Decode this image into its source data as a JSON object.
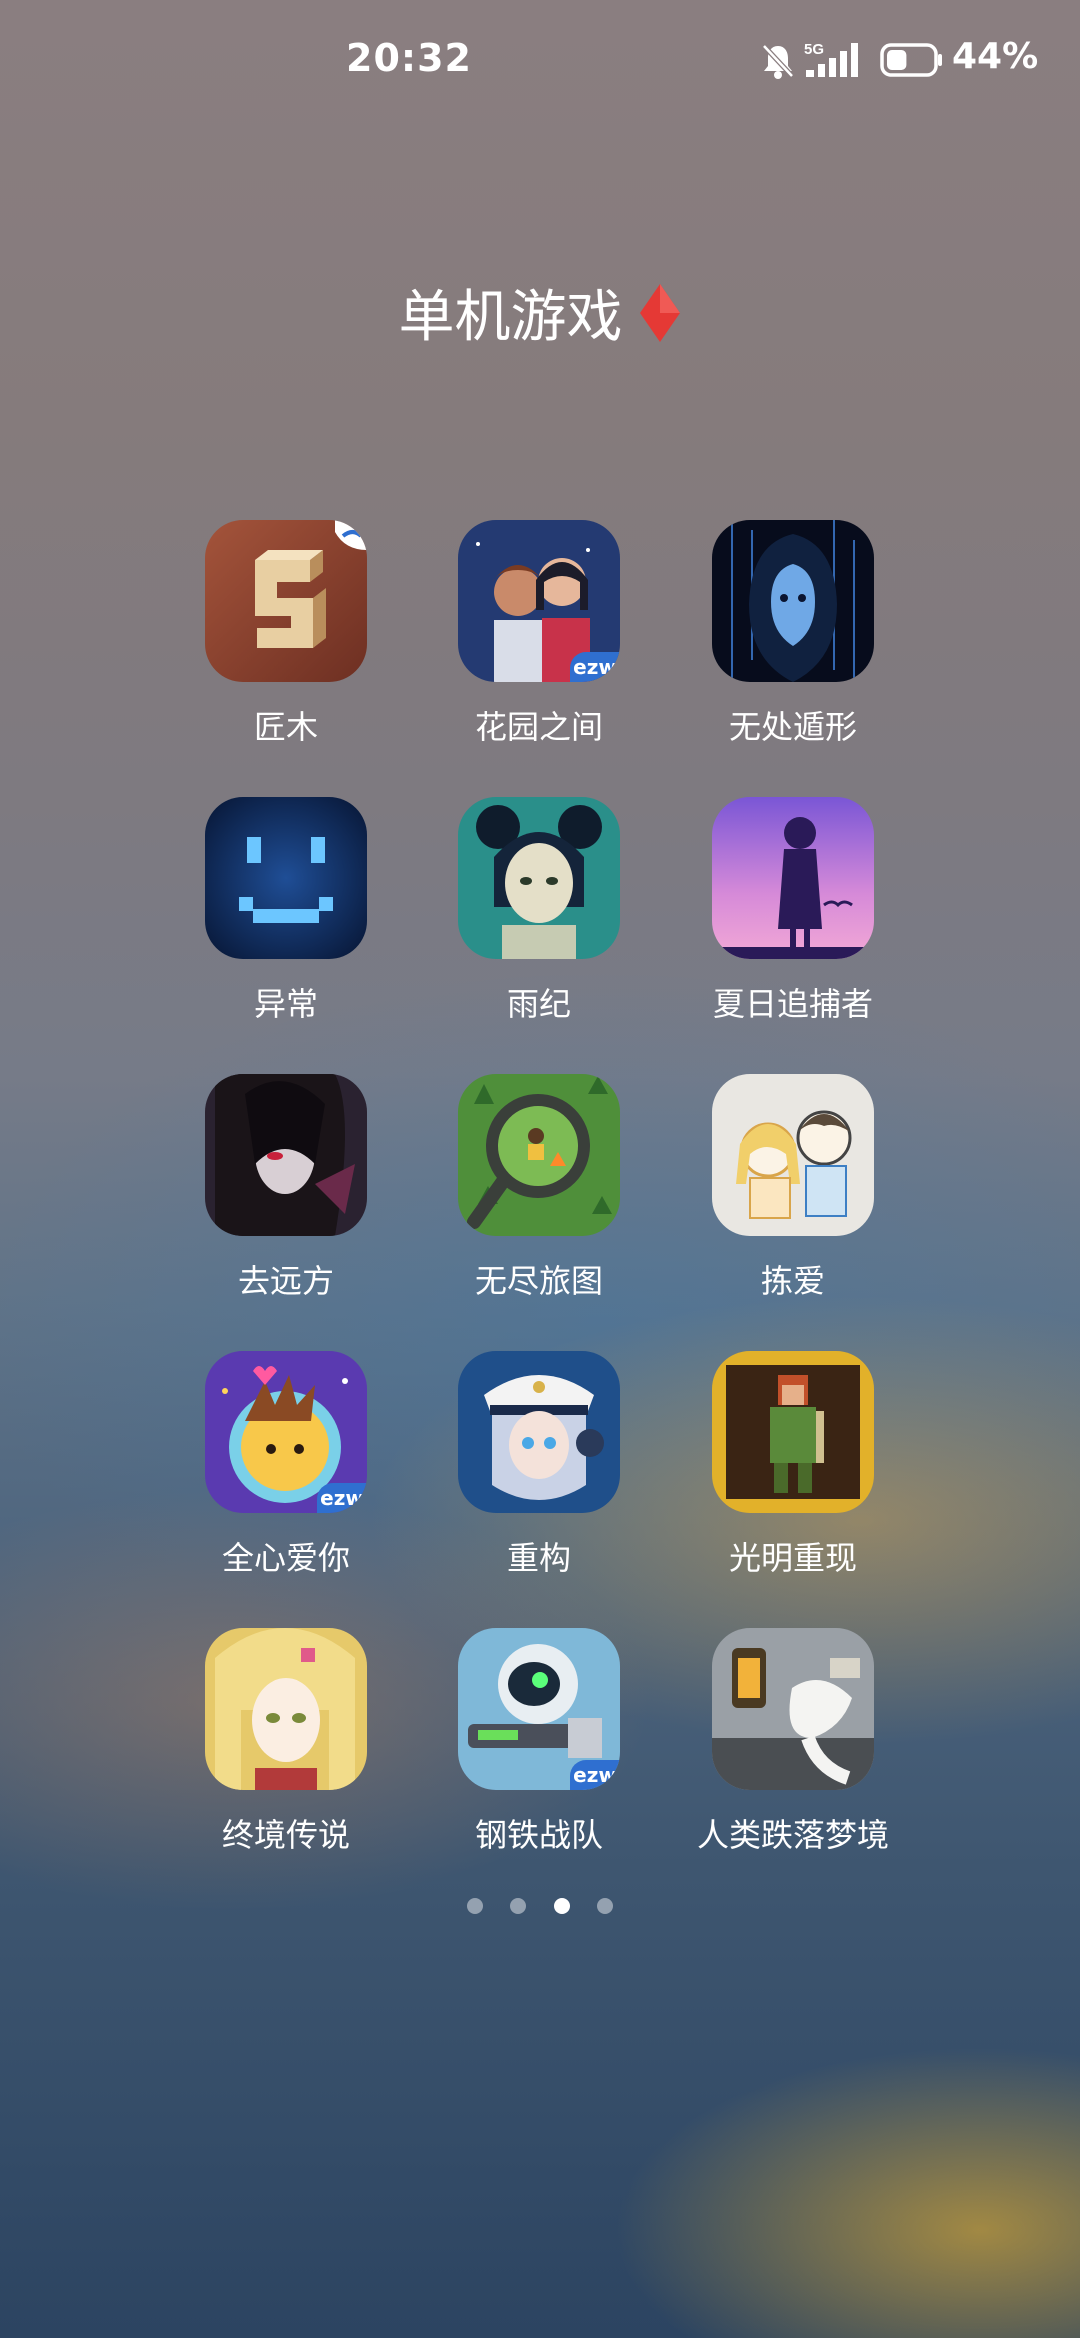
{
  "status_bar": {
    "time": "20:32",
    "network": "5G",
    "battery_percent": "44%",
    "battery_level": 0.44
  },
  "folder": {
    "title": "单机游戏",
    "title_emoji_color": "#e53935"
  },
  "apps": [
    {
      "label": "匠木",
      "icon": "wooden-block-puzzle-icon"
    },
    {
      "label": "花园之间",
      "icon": "two-girls-illustration-icon",
      "badge": "ezw"
    },
    {
      "label": "无处遁形",
      "icon": "hooded-figure-matrix-icon"
    },
    {
      "label": "异常",
      "icon": "pixel-smiley-icon"
    },
    {
      "label": "雨纪",
      "icon": "girl-portrait-icon"
    },
    {
      "label": "夏日追捕者",
      "icon": "purple-sunset-silhouette-icon"
    },
    {
      "label": "去远方",
      "icon": "dark-anime-girl-icon"
    },
    {
      "label": "无尽旅图",
      "icon": "magnifier-forest-icon"
    },
    {
      "label": "拣爱",
      "icon": "sketch-couple-icon"
    },
    {
      "label": "全心爱你",
      "icon": "boy-in-space-icon",
      "badge": "ezw"
    },
    {
      "label": "重构",
      "icon": "anime-captain-girl-icon"
    },
    {
      "label": "光明重现",
      "icon": "pixel-warrior-icon"
    },
    {
      "label": "终境传说",
      "icon": "blonde-anime-girl-icon"
    },
    {
      "label": "钢铁战队",
      "icon": "robot-gunner-icon",
      "badge": "ezw"
    },
    {
      "label": "人类跌落梦境",
      "icon": "lantern-ragdoll-icon"
    }
  ],
  "pager": {
    "pages": 4,
    "current": 3
  }
}
